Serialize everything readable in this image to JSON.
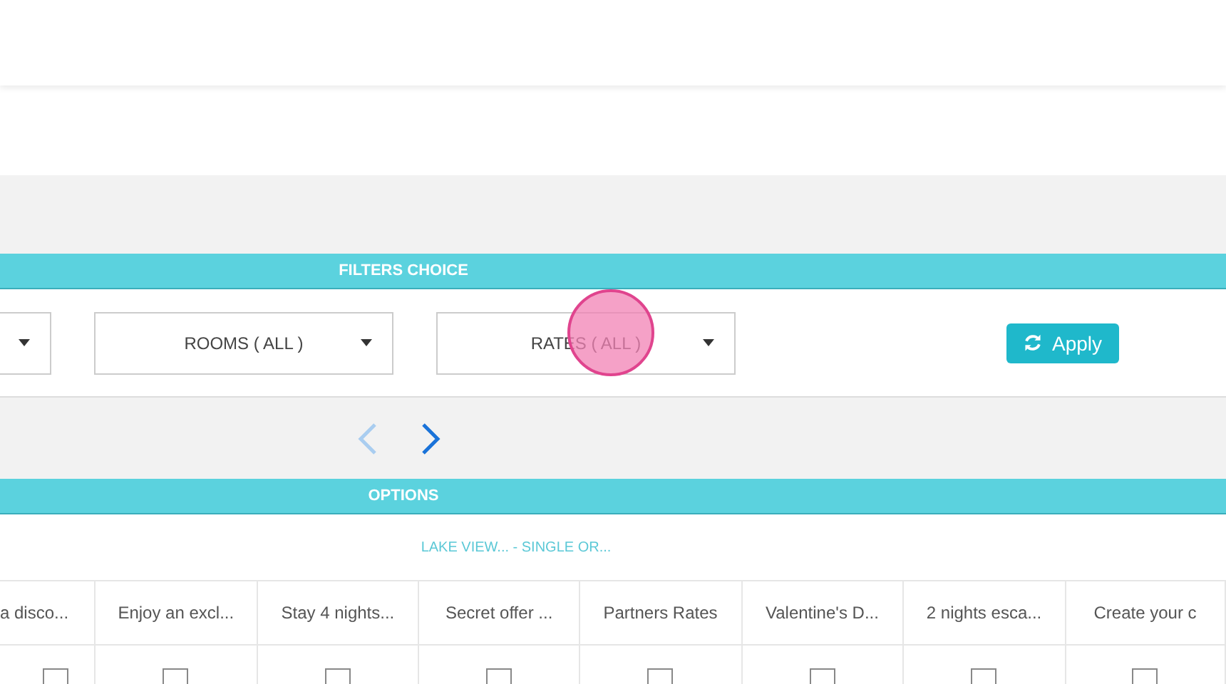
{
  "filters": {
    "title": "FILTERS CHOICE",
    "dropdowns": [
      {
        "label": "ROOMS ( ALL )"
      },
      {
        "label": "RATES ( ALL )"
      }
    ],
    "apply": "Apply"
  },
  "pager": {
    "prev_disabled": true,
    "next_disabled": false
  },
  "options": {
    "title": "OPTIONS",
    "room": "LAKE VIEW... - SINGLE OR...",
    "columns": [
      {
        "label": "a disco...",
        "checked": false
      },
      {
        "label": "Enjoy an excl...",
        "checked": false
      },
      {
        "label": "Stay 4 nights...",
        "checked": false
      },
      {
        "label": "Secret offer ...",
        "checked": false
      },
      {
        "label": "Partners Rates",
        "checked": false
      },
      {
        "label": "Valentine's D...",
        "checked": false
      },
      {
        "label": "2 nights esca...",
        "checked": false
      },
      {
        "label": "Create your c",
        "checked": false
      }
    ]
  }
}
